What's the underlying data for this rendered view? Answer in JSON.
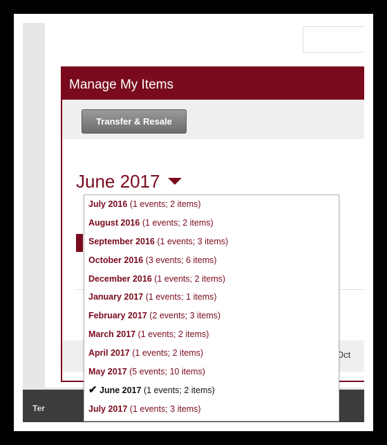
{
  "panel": {
    "title": "Manage My Items",
    "transfer_button": "Transfer & Resale"
  },
  "month_selector": {
    "label": "June 2017"
  },
  "background": {
    "oct_label": "Oct",
    "footer_text": "Ter"
  },
  "dropdown": {
    "items": [
      {
        "month": "July 2016",
        "count": "(1 events; 2 items)",
        "check": ""
      },
      {
        "month": "August 2016",
        "count": "(1 events; 2 items)",
        "check": ""
      },
      {
        "month": "September 2016",
        "count": "(1 events; 3 items)",
        "check": ""
      },
      {
        "month": "October 2016",
        "count": "(3 events; 6 items)",
        "check": ""
      },
      {
        "month": "December 2016",
        "count": "(1 events; 2 items)",
        "check": ""
      },
      {
        "month": "January 2017",
        "count": "(1 events; 1 items)",
        "check": ""
      },
      {
        "month": "February 2017",
        "count": "(2 events; 3 items)",
        "check": ""
      },
      {
        "month": "March 2017",
        "count": "(1 events; 2 items)",
        "check": ""
      },
      {
        "month": "April 2017",
        "count": "(1 events; 2 items)",
        "check": ""
      },
      {
        "month": "May 2017",
        "count": "(5 events; 10 items)",
        "check": ""
      },
      {
        "month": "June 2017",
        "count": "(1 events; 2 items)",
        "check": "✔"
      },
      {
        "month": "July 2017",
        "count": "(1 events; 3 items)",
        "check": ""
      }
    ]
  }
}
